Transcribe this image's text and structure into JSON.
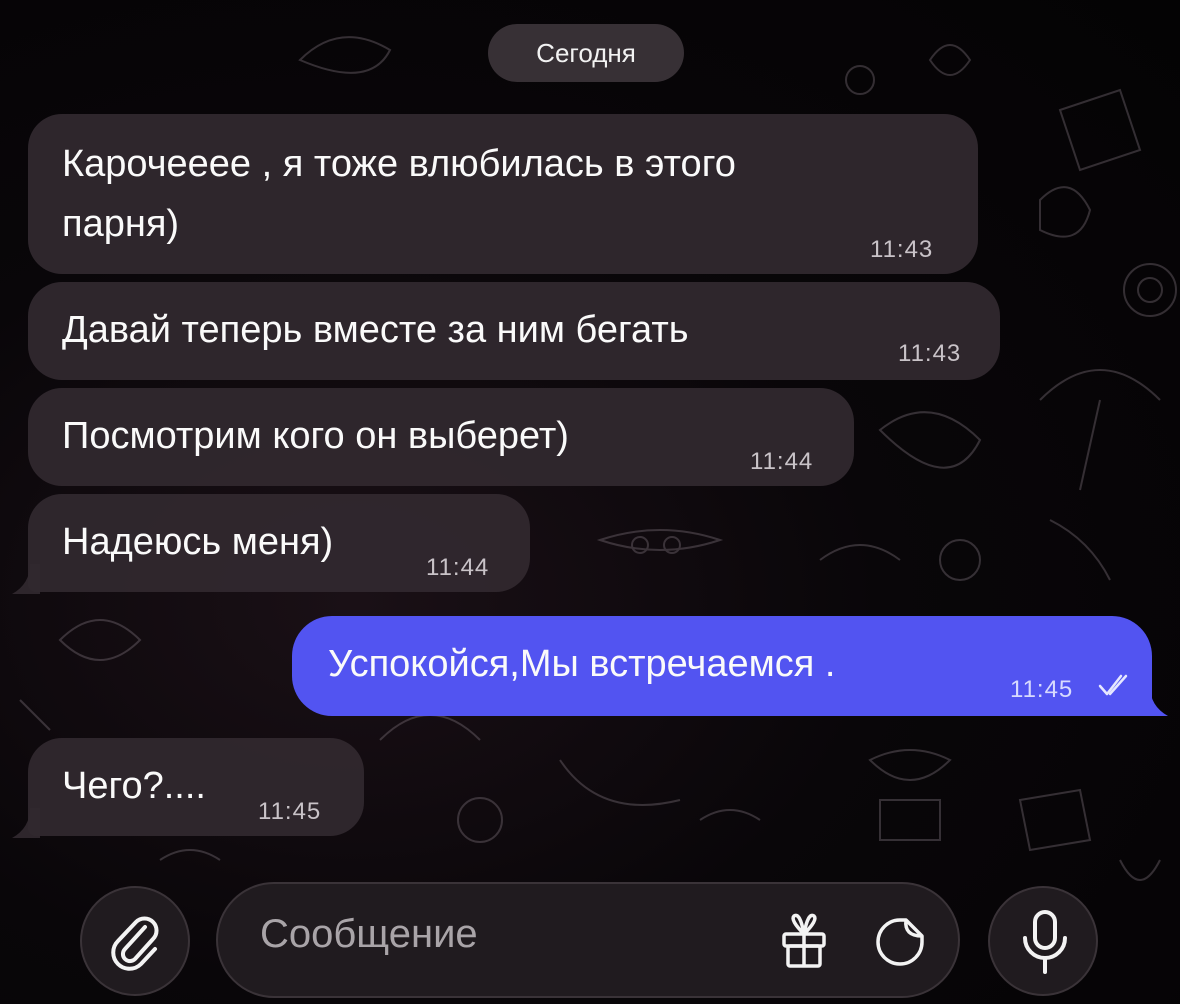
{
  "chat": {
    "date_separator": "Сегодня",
    "messages": [
      {
        "direction": "incoming",
        "line1": "Карочееее , я тоже влюбилась в этого",
        "line2": "парня)",
        "time": "11:43"
      },
      {
        "direction": "incoming",
        "text": "Давай теперь вместе за ним бегать",
        "time": "11:43"
      },
      {
        "direction": "incoming",
        "text": "Посмотрим кого он выберет)",
        "time": "11:44"
      },
      {
        "direction": "incoming",
        "text": "Надеюсь меня)",
        "time": "11:44"
      },
      {
        "direction": "outgoing",
        "text": "Успокойся,Мы встречаемся .",
        "time": "11:45",
        "status_icon": "double-check-icon"
      },
      {
        "direction": "incoming",
        "text": "Чего?....",
        "time": "11:45"
      }
    ]
  },
  "composer": {
    "placeholder": "Сообщение",
    "icons": {
      "attach": "paperclip-icon",
      "gift": "gift-icon",
      "sticker": "sticker-icon",
      "voice": "microphone-icon"
    }
  },
  "colors": {
    "incoming_bubble": "#30282e",
    "outgoing_bubble": "#5254f1",
    "background": "#090609"
  }
}
